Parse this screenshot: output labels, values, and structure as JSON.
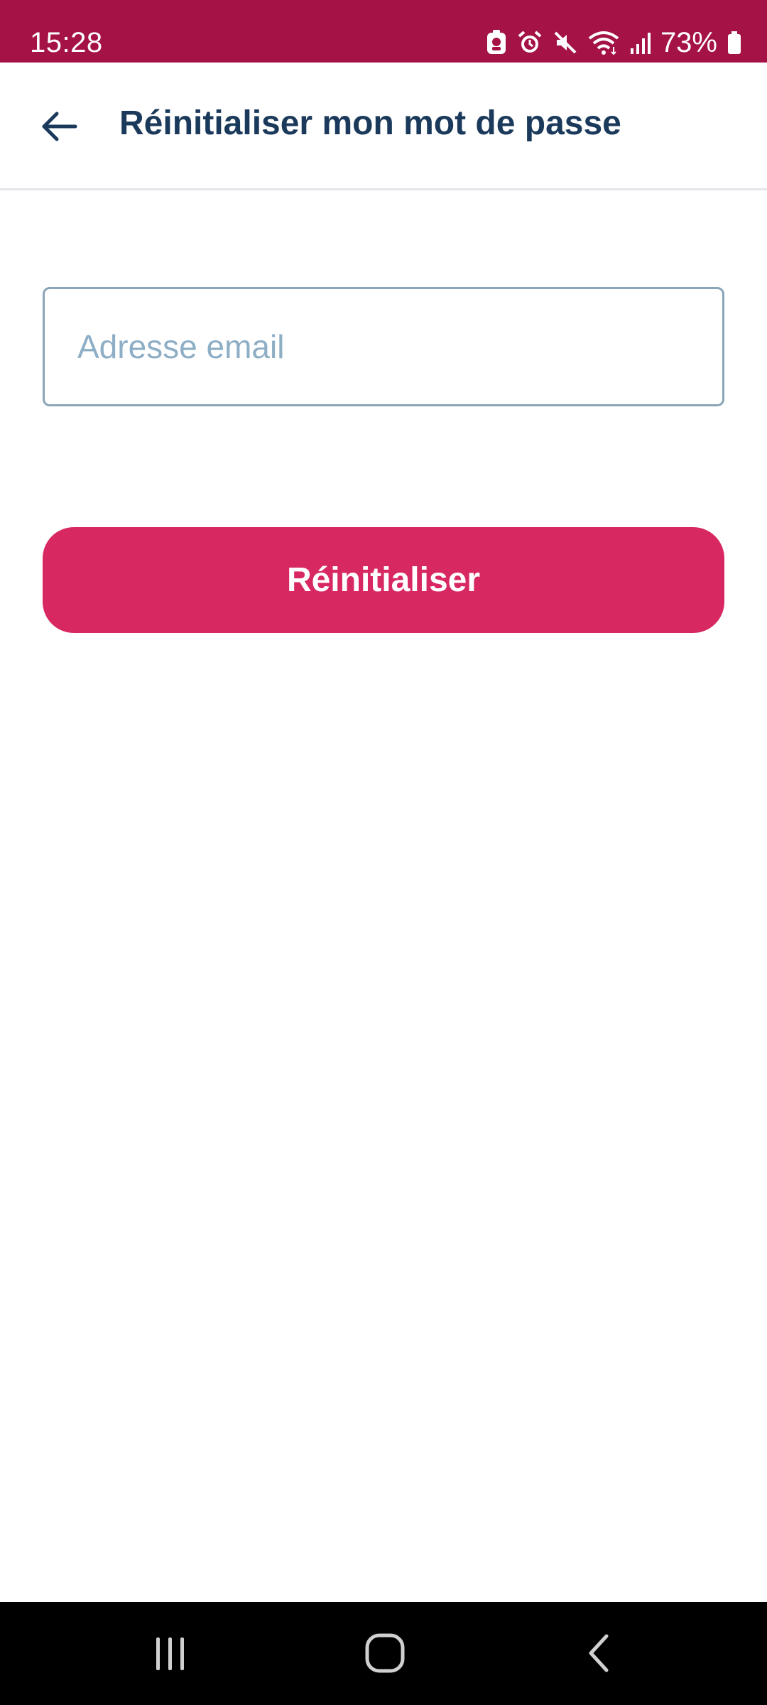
{
  "status_bar": {
    "time": "15:28",
    "battery": "73%",
    "icons": [
      "notification-icon",
      "alarm-icon",
      "mute-icon",
      "wifi-icon",
      "signal-icon",
      "battery-icon"
    ]
  },
  "app_bar": {
    "back_icon": "arrow-left-icon",
    "title": "Réinitialiser mon mot de passe"
  },
  "form": {
    "email_placeholder": "Adresse email",
    "email_value": "",
    "reset_label": "Réinitialiser"
  },
  "nav_bar": {
    "icons": [
      "recents-icon",
      "home-icon",
      "back-icon"
    ]
  },
  "colors": {
    "status_bar": "#a51346",
    "title_text": "#1b3a5b",
    "input_border": "#8aa5b8",
    "placeholder": "#8eaec6",
    "primary_button": "#d82862"
  }
}
